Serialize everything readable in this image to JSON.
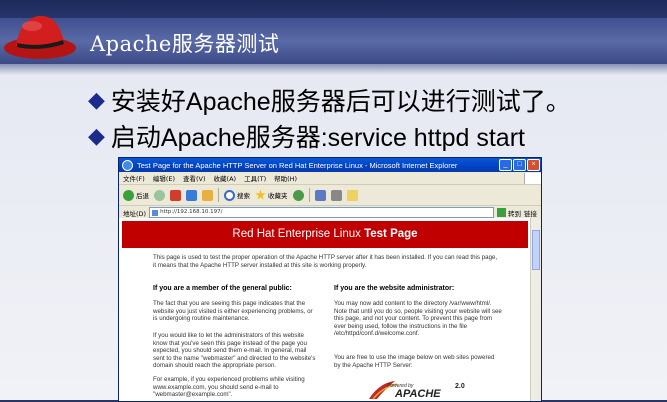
{
  "slide": {
    "title": "Apache服务器测试",
    "bullets": [
      "安装好Apache服务器后可以进行测试了。",
      "启动Apache服务器:service httpd start"
    ]
  },
  "browser": {
    "window_title": "Test Page for the Apache HTTP Server on Red Hat Enterprise Linux - Microsoft Internet Explorer",
    "menu": [
      "文件(F)",
      "编辑(E)",
      "查看(V)",
      "收藏(A)",
      "工具(T)",
      "帮助(H)"
    ],
    "toolbar": {
      "back": "后退",
      "search": "搜索",
      "favorites": "收藏夹"
    },
    "address_label": "地址(D)",
    "address_value": "http://192.168.10.197/",
    "go_label": "转到",
    "links_label": "链接"
  },
  "page": {
    "banner_prefix": "Red Hat Enterprise Linux ",
    "banner_bold": "Test Page",
    "intro": "This page is used to test the proper operation of the Apache HTTP server after it has been installed. If you can read this page, it means that the Apache HTTP server installed at this site is working properly.",
    "left_heading": "If you are a member of the general public:",
    "left_p1": "The fact that you are seeing this page indicates that the website you just visited is either experiencing problems, or is undergoing routine maintenance.",
    "left_p2": "If you would like to let the administrators of this website know that you've seen this page instead of the page you expected, you should send them e-mail. In general, mail sent to the name \"webmaster\" and directed to the website's domain should reach the appropriate person.",
    "left_p3": "For example, if you experienced problems while visiting www.example.com, you should send e-mail to \"webmaster@example.com\".",
    "right_heading": "If you are the website administrator:",
    "right_p1": "You may now add content to the directory /var/www/html/. Note that until you do so, people visiting your website will see this page, and not your content. To prevent this page from ever being used, follow the instructions in the file /etc/httpd/conf.d/welcome.conf.",
    "right_p2": "You are free to use the image below on web sites powered by the Apache HTTP Server:",
    "logo_powered": "Powered by",
    "logo_apache": "APACHE",
    "logo_version": "2.0"
  },
  "colors": {
    "banner": "#c00000",
    "title_bar": "#3b4a86",
    "bullet_mark": "#1c2a8c"
  }
}
